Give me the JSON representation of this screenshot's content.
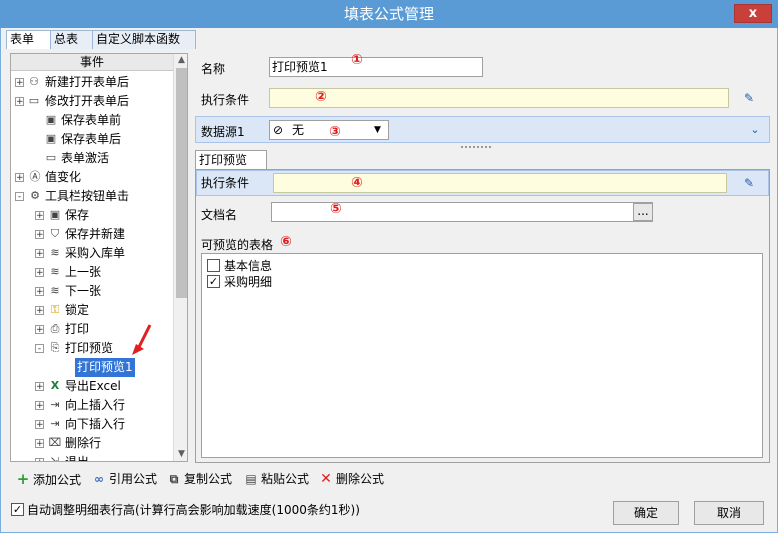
{
  "window": {
    "title": "填表公式管理",
    "close_label": "x"
  },
  "tabs": [
    "表单",
    "总表",
    "自定义脚本函数"
  ],
  "tree": {
    "header": "事件",
    "items": [
      {
        "label": "新建打开表单后",
        "icon": "person-icon",
        "expander": "+"
      },
      {
        "label": "修改打开表单后",
        "icon": "folder-icon",
        "expander": "+"
      },
      {
        "label": "保存表单前",
        "icon": "save-icon",
        "expander": ""
      },
      {
        "label": "保存表单后",
        "icon": "save-icon",
        "expander": ""
      },
      {
        "label": "表单激活",
        "icon": "folder-icon",
        "expander": ""
      },
      {
        "label": "值变化",
        "icon": "value-change-icon",
        "expander": "+"
      },
      {
        "label": "工具栏按钮单击",
        "icon": "tools-icon",
        "expander": "-"
      },
      {
        "label": "保存",
        "icon": "save-icon",
        "expander": "+"
      },
      {
        "label": "保存并新建",
        "icon": "shield-icon",
        "expander": "+"
      },
      {
        "label": "采购入库单",
        "icon": "layers-icon",
        "expander": "+"
      },
      {
        "label": "上一张",
        "icon": "layers-icon",
        "expander": "+"
      },
      {
        "label": "下一张",
        "icon": "layers-icon",
        "expander": "+"
      },
      {
        "label": "锁定",
        "icon": "lock-icon",
        "expander": "+"
      },
      {
        "label": "打印",
        "icon": "print-icon",
        "expander": "+"
      },
      {
        "label": "打印预览",
        "icon": "print-preview-icon",
        "expander": "-"
      },
      {
        "label": "打印预览1",
        "icon": "",
        "expander": ""
      },
      {
        "label": "导出Excel",
        "icon": "excel-icon",
        "expander": "+"
      },
      {
        "label": "向上插入行",
        "icon": "insert-row-icon",
        "expander": "+"
      },
      {
        "label": "向下插入行",
        "icon": "insert-row-icon",
        "expander": "+"
      },
      {
        "label": "删除行",
        "icon": "delete-row-icon",
        "expander": "+"
      },
      {
        "label": "退出",
        "icon": "exit-icon",
        "expander": "+"
      }
    ]
  },
  "form": {
    "name_label": "名称",
    "name_value": "打印预览1",
    "cond_label": "执行条件",
    "cond_value": "",
    "datasource_label": "数据源1",
    "datasource_value": "无",
    "inner_tab": "打印预览",
    "cond2_label": "执行条件",
    "cond2_value": "",
    "docname_label": "文档名",
    "docname_value": "",
    "browse_label": "...",
    "preview_tables_label": "可预览的表格",
    "tables": [
      {
        "label": "基本信息",
        "checked": false
      },
      {
        "label": "采购明细",
        "checked": true
      }
    ]
  },
  "markers": [
    "①",
    "②",
    "③",
    "④",
    "⑤",
    "⑥"
  ],
  "toolbar": {
    "add": "添加公式",
    "ref": "引用公式",
    "copy": "复制公式",
    "paste": "粘贴公式",
    "delete": "删除公式"
  },
  "footer": {
    "auto_adjust_label": "自动调整明细表行高(计算行高会影响加载速度(1000条约1秒))",
    "auto_adjust_checked": true,
    "ok": "确定",
    "cancel": "取消"
  },
  "colors": {
    "titlebar": "#5b9bd5",
    "close": "#c9403a",
    "marker": "#e02020",
    "selection": "#3375d6"
  }
}
